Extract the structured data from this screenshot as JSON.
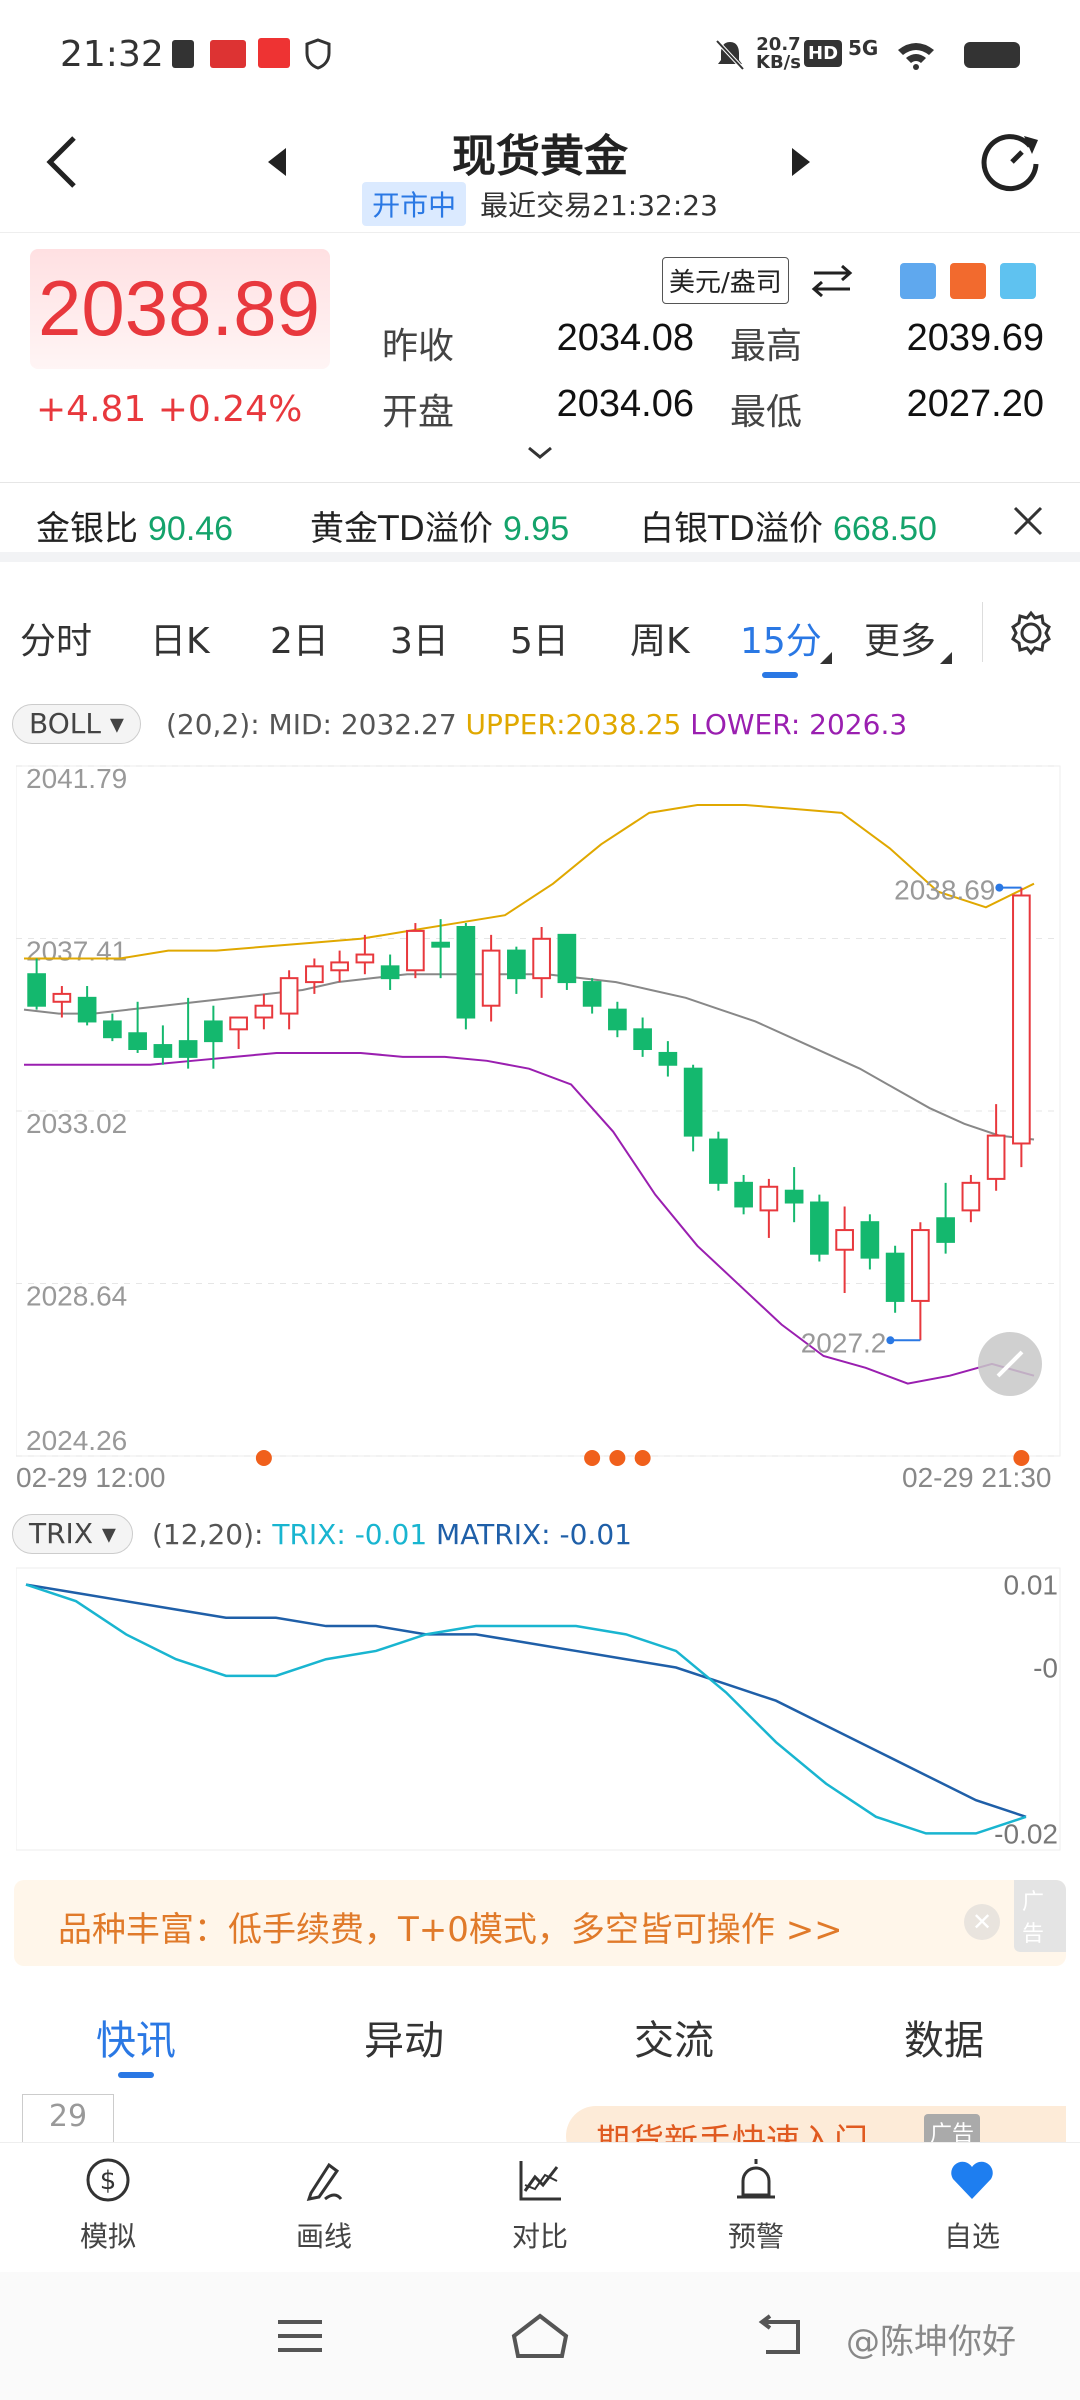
{
  "status": {
    "time": "21:32",
    "net_speed_top": "20.7",
    "net_speed_bottom": "KB/s",
    "hd": "HD",
    "signal": "5G"
  },
  "header": {
    "title": "现货黄金",
    "market_status": "开市中",
    "last_trade": "最近交易21:32:23"
  },
  "quote": {
    "price": "2038.89",
    "change": "+4.81 +0.24%",
    "unit": "美元/盎司",
    "prev_close_label": "昨收",
    "prev_close": "2034.08",
    "high_label": "最高",
    "high": "2039.69",
    "open_label": "开盘",
    "open": "2034.06",
    "low_label": "最低",
    "low": "2027.20",
    "price_color": "#e8383d"
  },
  "ratios": {
    "gold_silver_label": "金银比",
    "gold_silver": "90.46",
    "gold_td_label": "黄金TD溢价",
    "gold_td": "9.95",
    "silver_td_label": "白银TD溢价",
    "silver_td": "668.50"
  },
  "tabs": {
    "items": [
      "分时",
      "日K",
      "2日",
      "3日",
      "5日",
      "周K",
      "15分",
      "更多"
    ],
    "active": "15分"
  },
  "chart_data": [
    {
      "type": "candlestick",
      "indicator": "BOLL",
      "params": "(20,2):",
      "mid_text": "MID: 2032.27",
      "upper_text": "UPPER:2038.25",
      "lower_text": "LOWER: 2026.3",
      "y_ticks": [
        "2041.79",
        "2037.41",
        "2033.02",
        "2028.64",
        "2024.26"
      ],
      "ylim": [
        2024.26,
        2041.79
      ],
      "x_start": "02-29 12:00",
      "x_end": "02-29 21:30",
      "max_label": "2038.69",
      "min_label": "2027.2",
      "colors": {
        "up": "#e8383d",
        "down": "#14b86e",
        "mid": "#888888",
        "upper": "#e0a800",
        "lower": "#9a1fb0"
      },
      "candles": [
        [
          2036.5,
          2036.9,
          2035.6,
          2035.7
        ],
        [
          2035.8,
          2036.2,
          2035.4,
          2036.0
        ],
        [
          2035.9,
          2036.2,
          2035.2,
          2035.3
        ],
        [
          2035.3,
          2035.5,
          2034.8,
          2034.9
        ],
        [
          2035.0,
          2035.8,
          2034.5,
          2034.6
        ],
        [
          2034.7,
          2035.2,
          2034.2,
          2034.4
        ],
        [
          2034.8,
          2035.9,
          2034.1,
          2034.4
        ],
        [
          2035.3,
          2035.7,
          2034.1,
          2034.8
        ],
        [
          2035.1,
          2035.4,
          2034.6,
          2035.4
        ],
        [
          2035.4,
          2036.0,
          2035.1,
          2035.7
        ],
        [
          2035.5,
          2036.6,
          2035.1,
          2036.4
        ],
        [
          2036.3,
          2036.9,
          2036.0,
          2036.7
        ],
        [
          2036.6,
          2037.1,
          2036.3,
          2036.8
        ],
        [
          2036.8,
          2037.5,
          2036.5,
          2037.0
        ],
        [
          2036.7,
          2037.0,
          2036.1,
          2036.4
        ],
        [
          2036.6,
          2037.8,
          2036.4,
          2037.6
        ],
        [
          2037.3,
          2037.9,
          2036.4,
          2037.2
        ],
        [
          2037.7,
          2037.8,
          2035.1,
          2035.4
        ],
        [
          2035.7,
          2037.5,
          2035.3,
          2037.1
        ],
        [
          2037.1,
          2037.2,
          2036.0,
          2036.4
        ],
        [
          2036.4,
          2037.7,
          2035.9,
          2037.4
        ],
        [
          2037.5,
          2037.5,
          2036.1,
          2036.3
        ],
        [
          2036.3,
          2036.4,
          2035.5,
          2035.7
        ],
        [
          2035.6,
          2035.8,
          2034.9,
          2035.1
        ],
        [
          2035.1,
          2035.4,
          2034.4,
          2034.6
        ],
        [
          2034.5,
          2034.8,
          2033.9,
          2034.2
        ],
        [
          2034.1,
          2034.2,
          2032.0,
          2032.4
        ],
        [
          2032.3,
          2032.5,
          2031.0,
          2031.2
        ],
        [
          2031.2,
          2031.4,
          2030.4,
          2030.6
        ],
        [
          2030.5,
          2031.3,
          2029.8,
          2031.1
        ],
        [
          2031.0,
          2031.6,
          2030.2,
          2030.7
        ],
        [
          2030.7,
          2030.9,
          2029.2,
          2029.4
        ],
        [
          2029.5,
          2030.6,
          2028.4,
          2030.0
        ],
        [
          2030.2,
          2030.4,
          2029.0,
          2029.3
        ],
        [
          2029.4,
          2029.6,
          2027.9,
          2028.2
        ],
        [
          2028.2,
          2030.2,
          2027.2,
          2030.0
        ],
        [
          2030.3,
          2031.2,
          2029.4,
          2029.7
        ],
        [
          2030.5,
          2031.4,
          2030.2,
          2031.2
        ],
        [
          2031.3,
          2033.2,
          2031.0,
          2032.4
        ],
        [
          2032.2,
          2038.7,
          2031.6,
          2038.5
        ]
      ],
      "mid": [
        2035.6,
        2035.5,
        2035.5,
        2035.6,
        2035.7,
        2035.8,
        2035.9,
        2036.0,
        2036.1,
        2036.3,
        2036.4,
        2036.5,
        2036.5,
        2036.5,
        2036.5,
        2036.5,
        2036.4,
        2036.3,
        2036.1,
        2035.9,
        2035.6,
        2035.3,
        2034.9,
        2034.5,
        2034.1,
        2033.6,
        2033.1,
        2032.7,
        2032.4,
        2032.3
      ],
      "upper": [
        2036.9,
        2036.9,
        2036.9,
        2037.1,
        2037.1,
        2037.2,
        2037.3,
        2037.4,
        2037.6,
        2037.8,
        2038.0,
        2038.8,
        2039.8,
        2040.6,
        2040.8,
        2040.8,
        2040.7,
        2040.6,
        2039.7,
        2038.6,
        2038.2,
        2038.8
      ],
      "lower": [
        2034.2,
        2034.2,
        2034.2,
        2034.2,
        2034.3,
        2034.4,
        2034.5,
        2034.5,
        2034.5,
        2034.4,
        2034.4,
        2034.3,
        2034.1,
        2033.7,
        2032.5,
        2030.9,
        2029.6,
        2028.6,
        2027.6,
        2026.8,
        2026.5,
        2026.1,
        2026.3,
        2026.6,
        2026.3
      ],
      "markers_x": [
        9,
        22,
        23,
        24,
        39
      ]
    },
    {
      "type": "line",
      "indicator": "TRIX",
      "params": "(12,20):",
      "trix_text": "TRIX: -0.01",
      "matrix_text": "MATRIX: -0.01",
      "y_ticks": [
        "0.01",
        "-0",
        "-0.02"
      ],
      "ylim": [
        -0.022,
        0.012
      ],
      "colors": {
        "trix": "#19b5d0",
        "matrix": "#1f5fa8"
      },
      "trix": [
        0.01,
        0.008,
        0.004,
        0.001,
        -0.001,
        -0.001,
        0.001,
        0.002,
        0.004,
        0.005,
        0.005,
        0.005,
        0.004,
        0.002,
        -0.003,
        -0.009,
        -0.014,
        -0.018,
        -0.02,
        -0.02,
        -0.018
      ],
      "matrix": [
        0.01,
        0.009,
        0.008,
        0.007,
        0.006,
        0.006,
        0.005,
        0.005,
        0.004,
        0.004,
        0.003,
        0.002,
        0.001,
        0.0,
        -0.002,
        -0.004,
        -0.007,
        -0.01,
        -0.013,
        -0.016,
        -0.018
      ]
    }
  ],
  "ad": {
    "text": "品种丰富：低手续费，T+0模式，多空皆可操作 >>",
    "tag": "广告"
  },
  "news_tabs": [
    "快讯",
    "异动",
    "交流",
    "数据"
  ],
  "peek": {
    "date": "29",
    "banner": "期货新手快速入门",
    "tag": "广告"
  },
  "bottom_nav": [
    "模拟",
    "画线",
    "对比",
    "预警",
    "自选"
  ],
  "watermark": "@陈坤你好"
}
